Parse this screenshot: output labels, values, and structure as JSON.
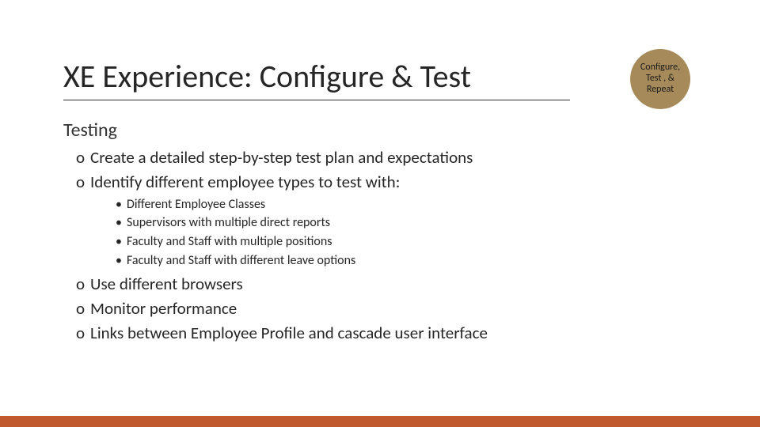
{
  "title": "XE Experience: Configure & Test",
  "badge": "Configure, Test , & Repeat",
  "subheading": "Testing",
  "bullets": {
    "o1": "Create a detailed step-by-step test plan and expectations",
    "o2": "Identify different employee types to test with:",
    "sub1": "Different Employee Classes",
    "sub2": "Supervisors with multiple direct reports",
    "sub3": "Faculty and Staff with multiple positions",
    "sub4": "Faculty and Staff with different leave options",
    "o3": "Use different browsers",
    "o4": "Monitor performance",
    "o5": "Links between Employee Profile and cascade user interface"
  },
  "accent_color": "#c0592e",
  "badge_color": "#a78a5a"
}
